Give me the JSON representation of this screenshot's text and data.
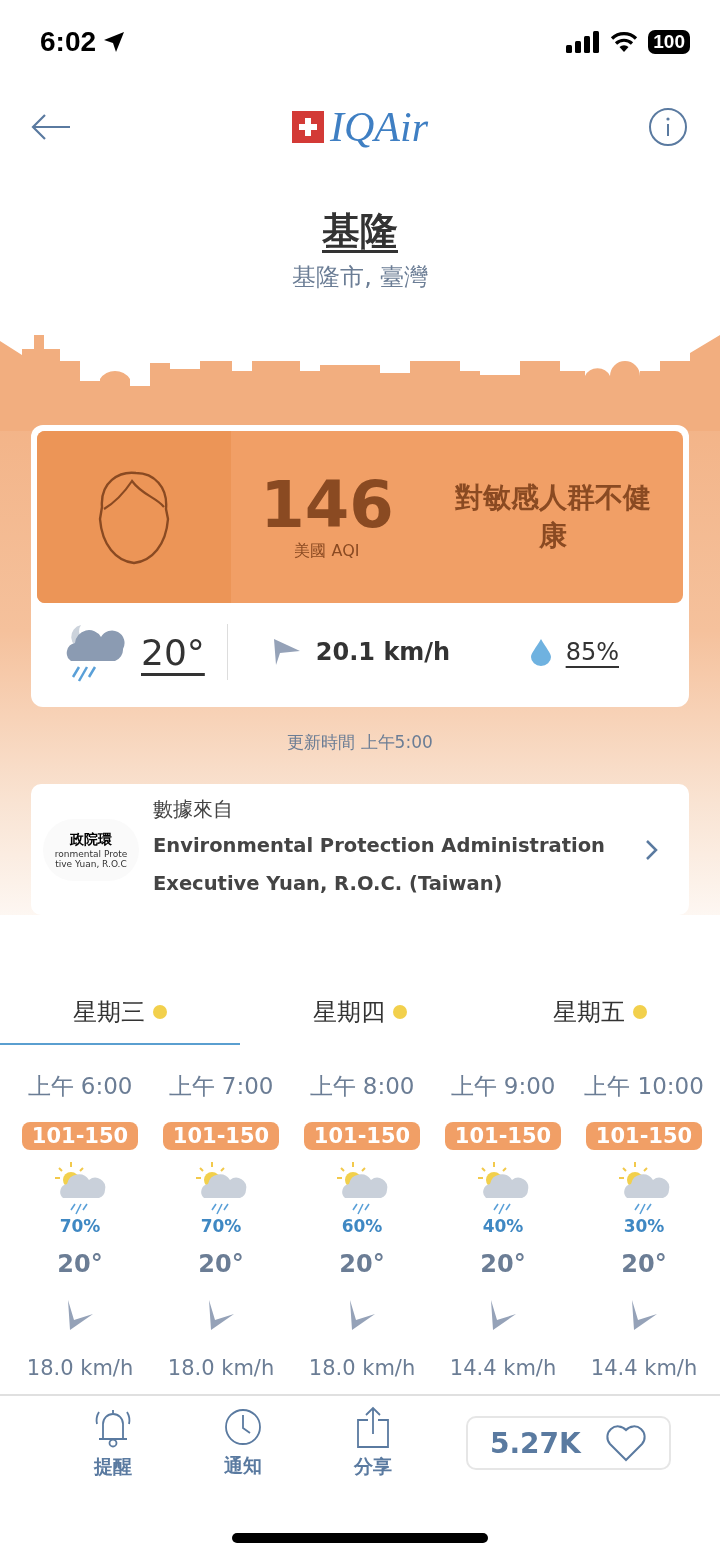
{
  "status_bar": {
    "time": "6:02",
    "battery": "100"
  },
  "header": {
    "logo": "IQAir"
  },
  "location": {
    "city": "基隆",
    "region": "基隆市, 臺灣"
  },
  "aqi": {
    "value": "146",
    "unit": "美國 AQI",
    "status": "對敏感人群不健康"
  },
  "weather": {
    "temperature": "20°",
    "wind": "20.1 km/h",
    "humidity": "85%"
  },
  "updated": "更新時間 上午5:00",
  "source": {
    "label": "數據來自",
    "logo_lines": [
      "政院環",
      "ronmental Prote",
      "tive Yuan, R.O.C"
    ],
    "name": "Environmental Protection Administration Executive Yuan, R.O.C. (Taiwan)"
  },
  "days": [
    {
      "label": "星期三",
      "selected": true
    },
    {
      "label": "星期四",
      "selected": false
    },
    {
      "label": "星期五",
      "selected": false
    }
  ],
  "hours": [
    {
      "time": "上午 6:00",
      "range": "101-150",
      "rain": "70%",
      "temp": "20°",
      "wind": "18.0 km/h"
    },
    {
      "time": "上午 7:00",
      "range": "101-150",
      "rain": "70%",
      "temp": "20°",
      "wind": "18.0 km/h"
    },
    {
      "time": "上午 8:00",
      "range": "101-150",
      "rain": "60%",
      "temp": "20°",
      "wind": "18.0 km/h"
    },
    {
      "time": "上午 9:00",
      "range": "101-150",
      "rain": "40%",
      "temp": "20°",
      "wind": "14.4 km/h"
    },
    {
      "time": "上午 10:00",
      "range": "101-150",
      "rain": "30%",
      "temp": "20°",
      "wind": "14.4 km/h"
    }
  ],
  "bottom_bar": {
    "items": [
      {
        "kind": "bell",
        "label": "提醒"
      },
      {
        "kind": "clock",
        "label": "通知"
      },
      {
        "kind": "share",
        "label": "分享"
      }
    ],
    "likes": "5.27K"
  }
}
